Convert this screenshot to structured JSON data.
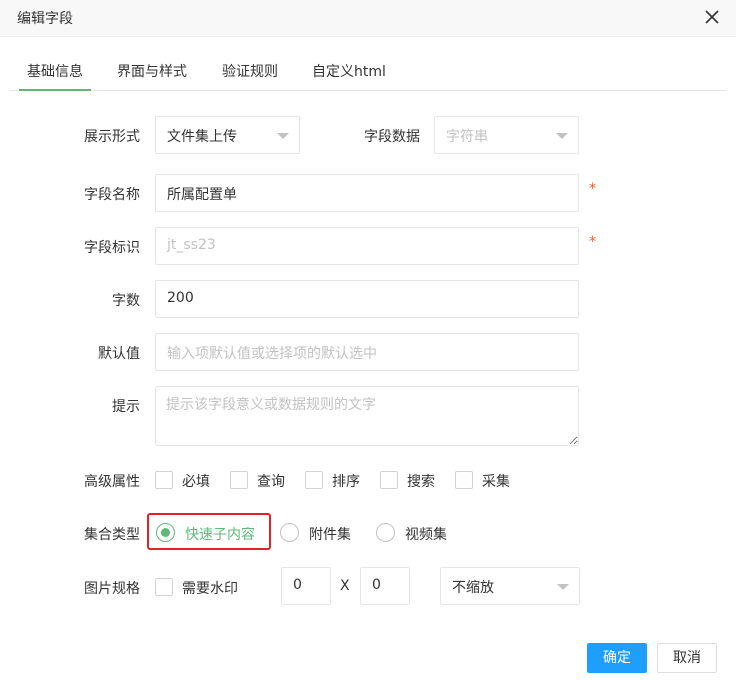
{
  "dialog": {
    "title": "编辑字段"
  },
  "tabs": [
    {
      "label": "基础信息",
      "active": true
    },
    {
      "label": "界面与样式"
    },
    {
      "label": "验证规则"
    },
    {
      "label": "自定义html"
    }
  ],
  "form": {
    "display_mode": {
      "label": "展示形式",
      "value": "文件集上传"
    },
    "field_data": {
      "label": "字段数据",
      "placeholder": "字符串"
    },
    "field_name": {
      "label": "字段名称",
      "value": "所属配置单",
      "required_mark": "*"
    },
    "field_key": {
      "label": "字段标识",
      "placeholder": "jt_ss23",
      "required_mark": "*"
    },
    "length": {
      "label": "字数",
      "value": "200"
    },
    "default_value": {
      "label": "默认值",
      "placeholder": "输入项默认值或选择项的默认选中"
    },
    "hint": {
      "label": "提示",
      "placeholder": "提示该字段意义或数据规则的文字"
    },
    "advanced": {
      "label": "高级属性",
      "options": [
        "必填",
        "查询",
        "排序",
        "搜索",
        "采集"
      ]
    },
    "collection_type": {
      "label": "集合类型",
      "options": [
        "快速子内容",
        "附件集",
        "视频集"
      ],
      "selected": "快速子内容"
    },
    "image_spec": {
      "label": "图片规格",
      "watermark_label": "需要水印",
      "width": "0",
      "separator": "X",
      "height": "0",
      "scale_mode": "不缩放"
    }
  },
  "footer": {
    "confirm_label": "确定",
    "cancel_label": "取消"
  },
  "colors": {
    "accent_green": "#5fb878",
    "primary_blue": "#1e9fff",
    "required_red": "#ff5722",
    "highlight_red": "#e02424"
  }
}
